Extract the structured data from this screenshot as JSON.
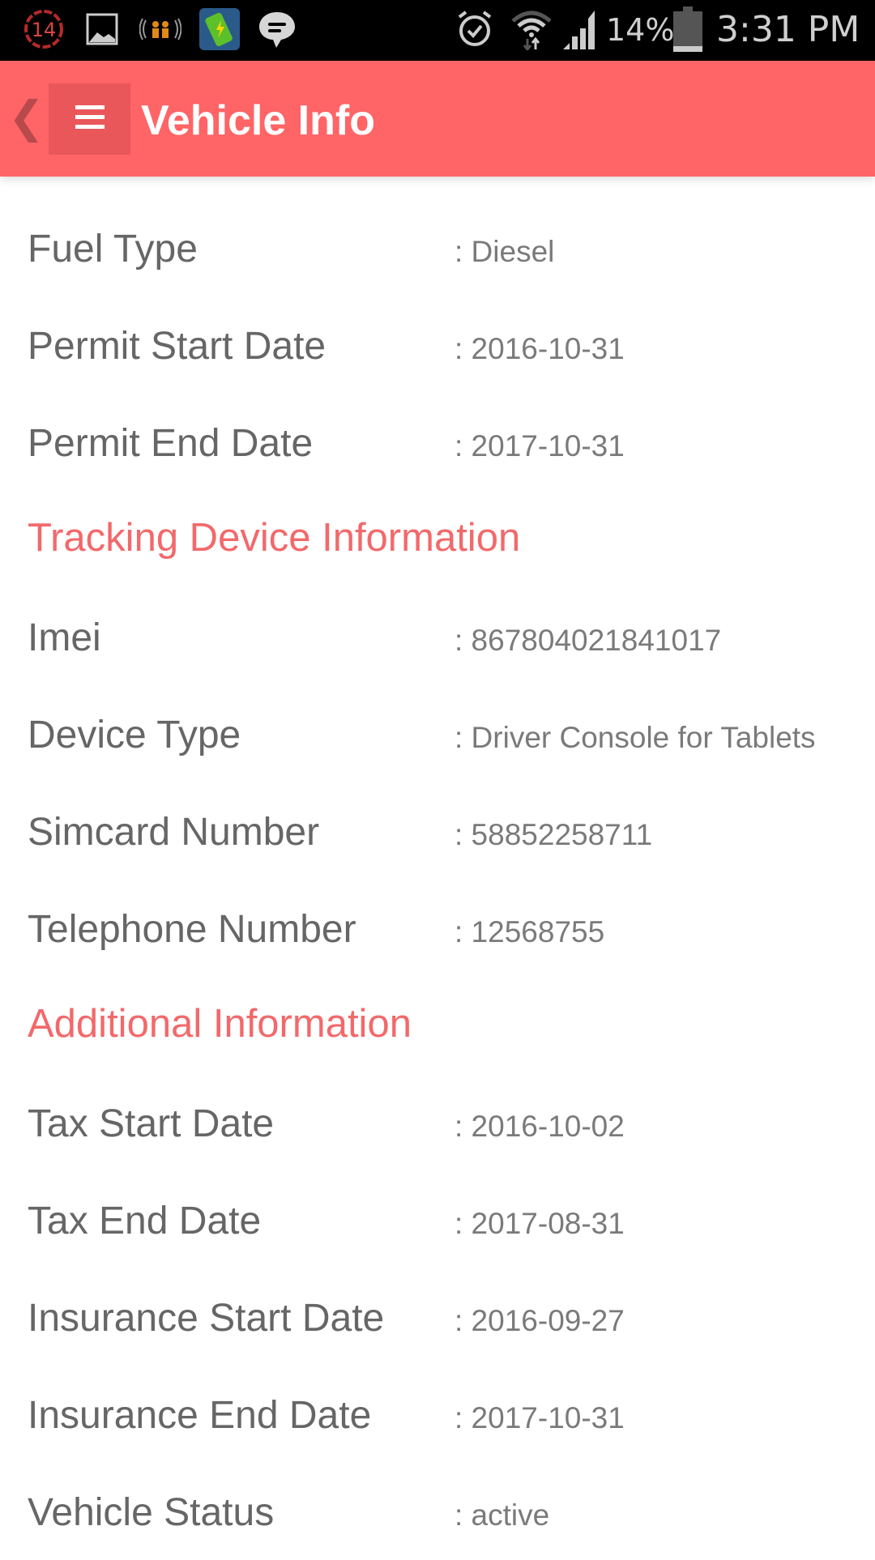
{
  "status_bar": {
    "notification_badge": "14",
    "battery_percent": "14%",
    "time": "3:31 PM",
    "battery_level": 0.14
  },
  "app_bar": {
    "title": "Vehicle Info",
    "back_icon": "chevron-left-icon",
    "menu_icon": "hamburger-menu-icon"
  },
  "colors": {
    "accent": "#ff6466",
    "section_heading": "#f2696b",
    "label": "#666666",
    "value": "#7a7a7a"
  },
  "rows_top": [
    {
      "label": "Fuel Type",
      "value": ": Diesel"
    },
    {
      "label": "Permit Start Date",
      "value": ": 2016-10-31"
    },
    {
      "label": "Permit End Date",
      "value": ": 2017-10-31"
    }
  ],
  "sections": [
    {
      "heading": "Tracking Device Information",
      "rows": [
        {
          "label": "Imei",
          "value": ": 867804021841017"
        },
        {
          "label": "Device Type",
          "value": ": Driver Console for Tablets"
        },
        {
          "label": "Simcard Number",
          "value": ": 58852258711"
        },
        {
          "label": "Telephone Number",
          "value": ": 12568755"
        }
      ]
    },
    {
      "heading": "Additional Information",
      "rows": [
        {
          "label": "Tax Start Date",
          "value": ": 2016-10-02"
        },
        {
          "label": "Tax End Date",
          "value": ": 2017-08-31"
        },
        {
          "label": "Insurance Start Date",
          "value": ": 2016-09-27"
        },
        {
          "label": "Insurance End Date",
          "value": ": 2017-10-31"
        },
        {
          "label": "Vehicle Status",
          "value": ": active"
        }
      ]
    }
  ]
}
